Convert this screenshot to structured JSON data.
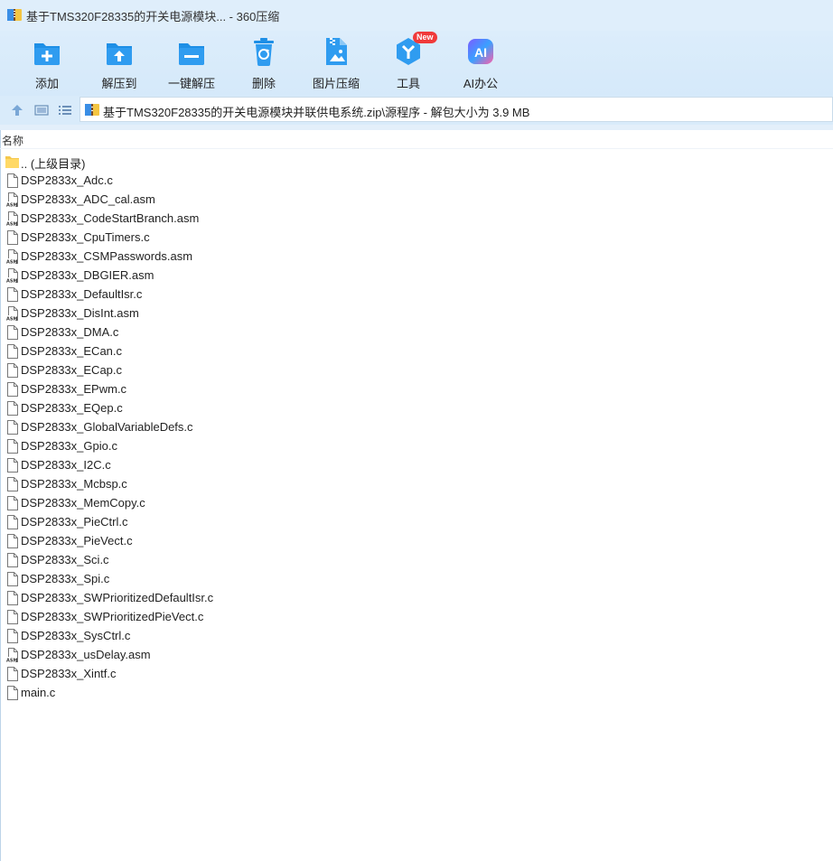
{
  "window": {
    "title": "基于TMS320F28335的开关电源模块... - 360压缩"
  },
  "toolbar": {
    "items": [
      {
        "label": "添加",
        "icon": "add-icon"
      },
      {
        "label": "解压到",
        "icon": "extract-to-icon"
      },
      {
        "label": "一键解压",
        "icon": "one-click-extract-icon"
      },
      {
        "label": "删除",
        "icon": "delete-icon"
      },
      {
        "label": "图片压缩",
        "icon": "image-compress-icon"
      },
      {
        "label": "工具",
        "icon": "tools-icon",
        "badge": "New"
      },
      {
        "label": "AI办公",
        "icon": "ai-office-icon",
        "icon_text": "AI"
      }
    ],
    "accent": "#1e8fe6",
    "badge_color": "#f03a3a"
  },
  "address": {
    "path": "基于TMS320F28335的开关电源模块并联供电系统.zip\\源程序 - 解包大小为 3.9 MB"
  },
  "list": {
    "column_name": "名称",
    "parent": ".. (上级目录)",
    "files": [
      {
        "name": "DSP2833x_Adc.c",
        "type": "c"
      },
      {
        "name": "DSP2833x_ADC_cal.asm",
        "type": "asm"
      },
      {
        "name": "DSP2833x_CodeStartBranch.asm",
        "type": "asm"
      },
      {
        "name": "DSP2833x_CpuTimers.c",
        "type": "c"
      },
      {
        "name": "DSP2833x_CSMPasswords.asm",
        "type": "asm"
      },
      {
        "name": "DSP2833x_DBGIER.asm",
        "type": "asm"
      },
      {
        "name": "DSP2833x_DefaultIsr.c",
        "type": "c"
      },
      {
        "name": "DSP2833x_DisInt.asm",
        "type": "asm"
      },
      {
        "name": "DSP2833x_DMA.c",
        "type": "c"
      },
      {
        "name": "DSP2833x_ECan.c",
        "type": "c"
      },
      {
        "name": "DSP2833x_ECap.c",
        "type": "c"
      },
      {
        "name": "DSP2833x_EPwm.c",
        "type": "c"
      },
      {
        "name": "DSP2833x_EQep.c",
        "type": "c"
      },
      {
        "name": "DSP2833x_GlobalVariableDefs.c",
        "type": "c"
      },
      {
        "name": "DSP2833x_Gpio.c",
        "type": "c"
      },
      {
        "name": "DSP2833x_I2C.c",
        "type": "c"
      },
      {
        "name": "DSP2833x_Mcbsp.c",
        "type": "c"
      },
      {
        "name": "DSP2833x_MemCopy.c",
        "type": "c"
      },
      {
        "name": "DSP2833x_PieCtrl.c",
        "type": "c"
      },
      {
        "name": "DSP2833x_PieVect.c",
        "type": "c"
      },
      {
        "name": "DSP2833x_Sci.c",
        "type": "c"
      },
      {
        "name": "DSP2833x_Spi.c",
        "type": "c"
      },
      {
        "name": "DSP2833x_SWPrioritizedDefaultIsr.c",
        "type": "c"
      },
      {
        "name": "DSP2833x_SWPrioritizedPieVect.c",
        "type": "c"
      },
      {
        "name": "DSP2833x_SysCtrl.c",
        "type": "c"
      },
      {
        "name": "DSP2833x_usDelay.asm",
        "type": "asm"
      },
      {
        "name": "DSP2833x_Xintf.c",
        "type": "c"
      },
      {
        "name": "main.c",
        "type": "c"
      }
    ]
  }
}
